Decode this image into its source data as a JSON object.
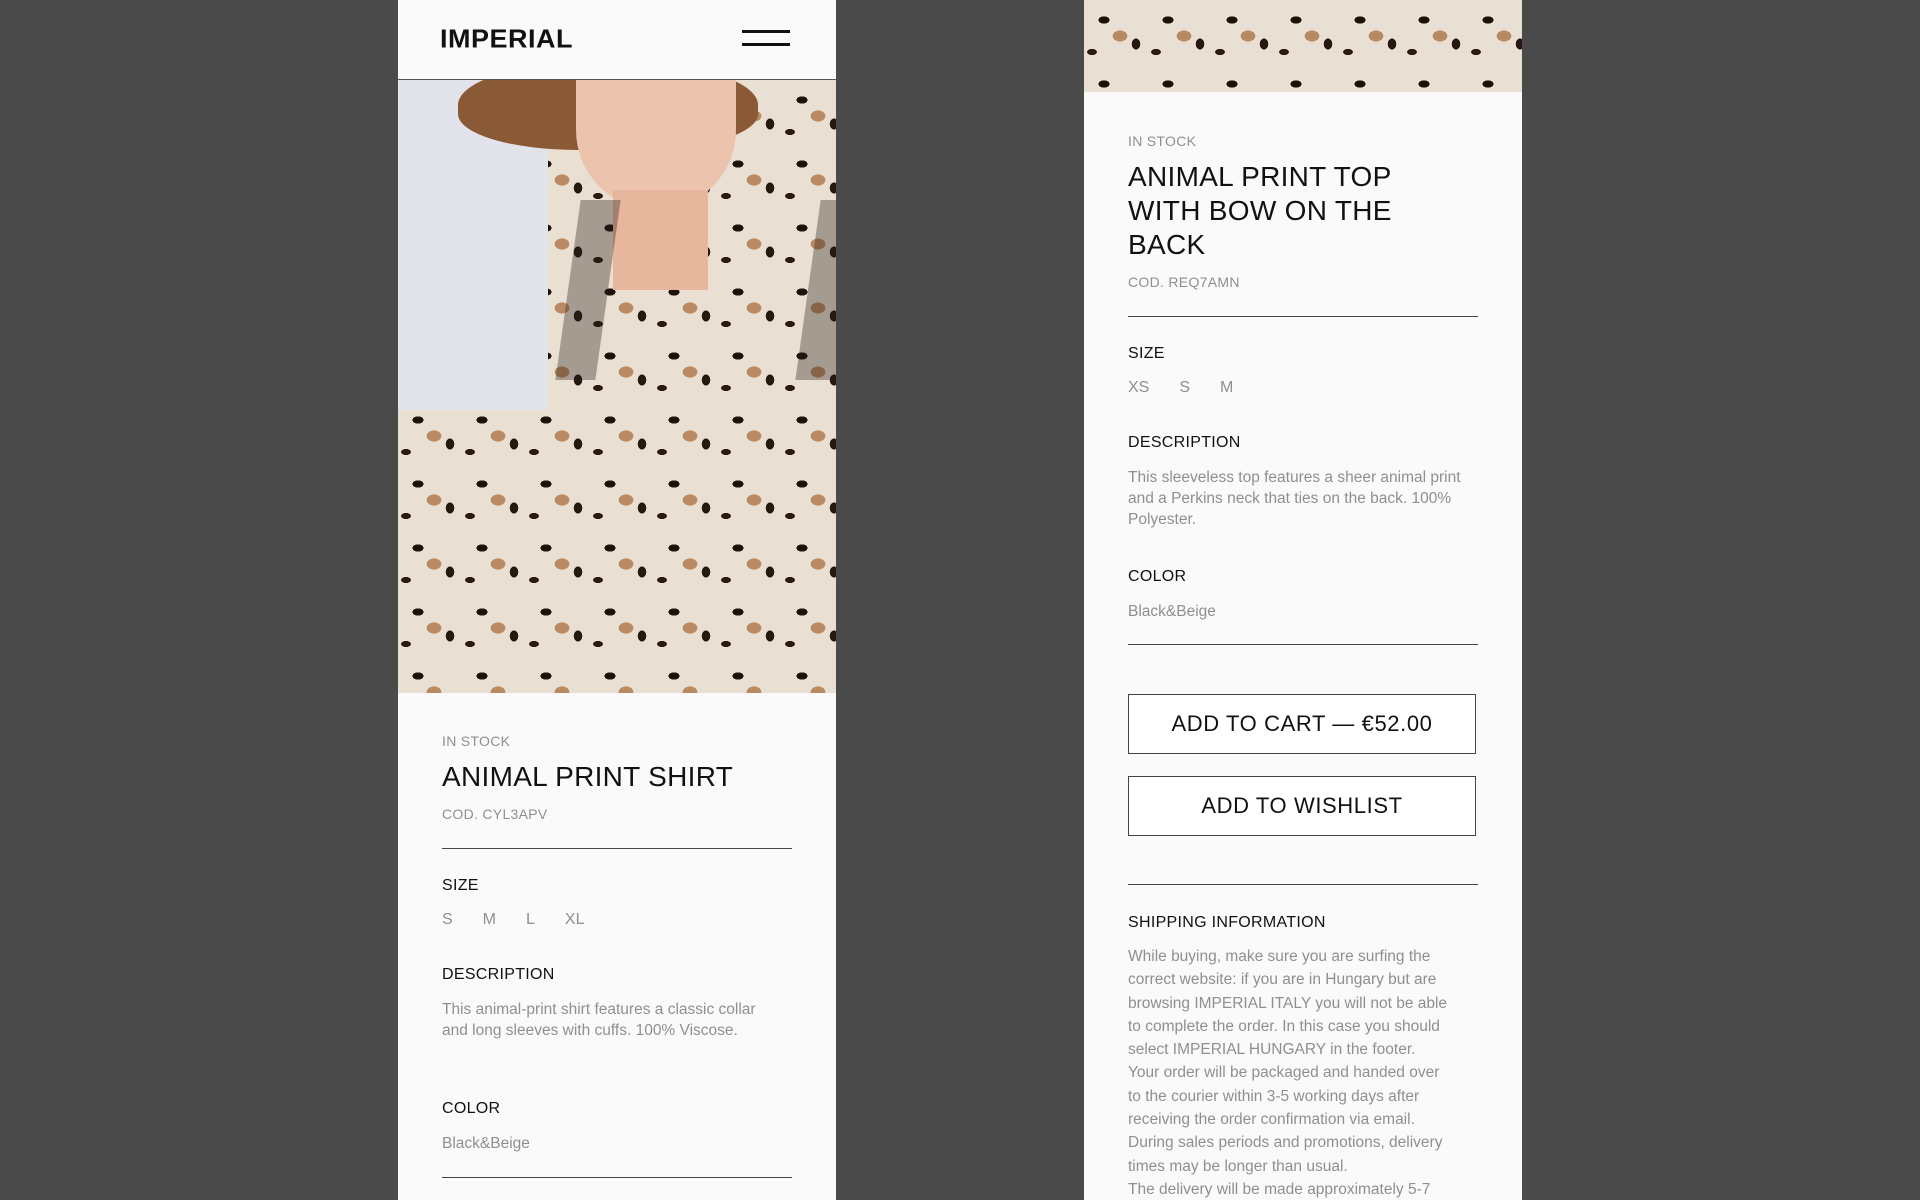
{
  "brand": {
    "logo": "IMPERIAL"
  },
  "left_product": {
    "stock": "IN STOCK",
    "title": "ANIMAL PRINT SHIRT",
    "code": "COD. CYL3APV",
    "size_label": "SIZE",
    "sizes": [
      "S",
      "M",
      "L",
      "XL"
    ],
    "description_label": "DESCRIPTION",
    "description": "This animal-print shirt features a classic collar and long sleeves with cuffs. 100% Viscose.",
    "color_label": "COLOR",
    "color": "Black&Beige"
  },
  "right_product": {
    "stock": "IN STOCK",
    "title": "ANIMAL PRINT TOP WITH BOW ON THE BACK",
    "code": "COD. REQ7AMN",
    "size_label": "SIZE",
    "sizes": [
      "XS",
      "S",
      "M"
    ],
    "description_label": "DESCRIPTION",
    "description": "This sleeveless top features a sheer animal print and a Perkins neck that ties on the back. 100% Polyester.",
    "color_label": "COLOR",
    "color": "Black&Beige",
    "add_to_cart": "ADD TO CART — €52.00",
    "add_to_wishlist": "ADD TO WISHLIST",
    "shipping_label": "SHIPPING INFORMATION",
    "shipping_lines": [
      "While buying, make sure you are surfing the",
      "correct website: if you are in Hungary but are",
      "browsing IMPERIAL ITALY you will not be able",
      "to complete the order. In this case you should",
      "select IMPERIAL HUNGARY in the footer.",
      "Your order will be packaged and handed over",
      "to the courier within 3-5 working days after",
      "receiving the order confirmation via email.",
      "During sales periods and promotions, delivery",
      "times may be longer than usual.",
      "The delivery will be made approximately 5-7"
    ]
  },
  "colors": {
    "background": "#4a4a4a",
    "panel": "#fafafa",
    "text": "#111111",
    "muted": "#8f8f8f"
  }
}
